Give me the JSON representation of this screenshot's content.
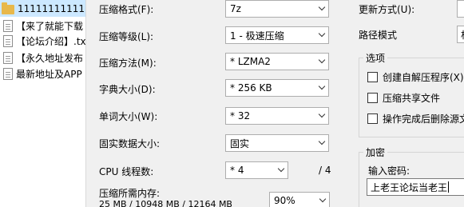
{
  "file_list": [
    {
      "name": "11111111111",
      "type": "folder",
      "selected": true
    },
    {
      "name": "【来了就能下载",
      "type": "doc"
    },
    {
      "name": "【论坛介绍】.txt",
      "type": "doc"
    },
    {
      "name": "【永久地址发布",
      "type": "doc"
    },
    {
      "name": "最新地址及APP",
      "type": "doc"
    }
  ],
  "compression": {
    "format_label": "压缩格式(F):",
    "format_value": "7z",
    "level_label": "压缩等级(L):",
    "level_value": "1 - 极速压缩",
    "method_label": "压缩方法(M):",
    "method_value": "* LZMA2",
    "dict_label": "字典大小(D):",
    "dict_value": "* 256 KB",
    "word_label": "单词大小(W):",
    "word_value": "* 32",
    "solid_label": "固实数据大小:",
    "solid_value": "固实",
    "threads_label": "CPU 线程数:",
    "threads_value": "* 4",
    "threads_max": "/ 4",
    "memory_label": "压缩所需内存:",
    "memory_value": "25 MB / 10948 MB / 12164 MB",
    "memory_percent": "90%"
  },
  "right_panel": {
    "update_label": "更新方式(U):",
    "path_label": "路径模式",
    "path_value_partial": "相"
  },
  "options": {
    "title": "选项",
    "create_sfx": "创建自解压程序(X)",
    "compress_shared": "压缩共享文件",
    "delete_after": "操作完成后删除源文"
  },
  "encryption": {
    "title": "加密",
    "password_label": "输入密码:",
    "password_value": "上老王论坛当老王"
  }
}
